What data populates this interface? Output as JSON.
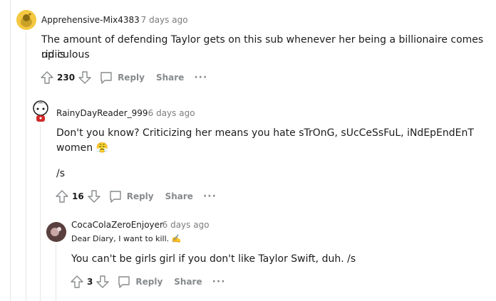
{
  "comments": [
    {
      "username": "Apprehensive-Mix4383",
      "time": "· 7 days ago",
      "body_line1": "The amount of defending Taylor gets on this sub whenever her being a billionaire comes up is",
      "body_line2": "ridiculous",
      "score": "230",
      "reply_label": "Reply",
      "share_label": "Share",
      "more_label": "···"
    },
    {
      "username": "RainyDayReader_999",
      "time": "· 6 days ago",
      "body_line1": "Don't you know? Criticizing her means you hate sTrOnG, sUcCeSsFuL, iNdEpEndEnT",
      "body_line2": "women 😤",
      "body_line3": "/s",
      "score": "16",
      "reply_label": "Reply",
      "share_label": "Share",
      "more_label": "···"
    },
    {
      "username": "CocaColaZeroEnjoyer",
      "time": "· 6 days ago",
      "flair": "Dear Diary, I want to kill. ✍️",
      "body_line1": "You can't be girls girl if you don't like Taylor Swift, duh. /s",
      "score": "3",
      "reply_label": "Reply",
      "share_label": "Share",
      "more_label": "···"
    }
  ],
  "colors": {
    "upvote_outline": "#878a8c",
    "thread_line": "#e5e5e5"
  }
}
